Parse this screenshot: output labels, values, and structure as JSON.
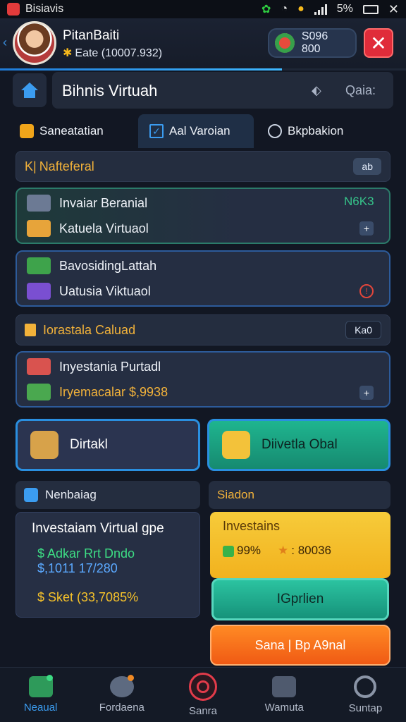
{
  "status_bar": {
    "app_name": "Bisiavis",
    "battery": "5%",
    "icons": [
      "app-icon",
      "wifi-icon",
      "bulb-icon",
      "signal-icon",
      "battery-icon",
      "close-icon"
    ]
  },
  "header": {
    "profile_name": "PitanBaiti",
    "profile_sub": "Eate (10007.932)",
    "coins": "S096 800",
    "close_label": "✕"
  },
  "title_bar": {
    "title": "Bihnis Virtuah",
    "search_text": "Qaia:"
  },
  "tabs": [
    {
      "label": "Saneatatian",
      "icon": "lock-icon"
    },
    {
      "label": "Aal Varoian",
      "icon": "check-icon",
      "active": true
    },
    {
      "label": "Bkpbakion",
      "icon": "clock-icon"
    }
  ],
  "section1": {
    "label": "Nafteferal",
    "prefix": "K|",
    "tag": "ab"
  },
  "cards": [
    {
      "title": "Invaiar Beranial",
      "subtitle": "Katuela Virtuaol",
      "badge": "N6K3",
      "action": "+"
    },
    {
      "title": "BavosidingLattah",
      "subtitle": "Uatusia Viktuaol",
      "action": "!"
    }
  ],
  "section2": {
    "label": "Iorastala Caluad",
    "tag": "Ka0"
  },
  "card3": {
    "title": "Inyestania Purtadl",
    "subtitle": "Iryemacalar $,9938",
    "action": "+"
  },
  "big_buttons": {
    "left": "Dirtakl",
    "right": "Diivetla Obal"
  },
  "left_panel": {
    "header": "Nenbaiag",
    "title": "Investaiam Virtual gpe",
    "line1": "$ Adkar Rrt Dndo",
    "line2": "$,1011 17/280",
    "line3": "$ Sket (33,7085%"
  },
  "right_panel": {
    "header": "Siadon",
    "gold_title": "Investains",
    "stat1": "99%",
    "stat2": ": 80036",
    "option_label": "IGprlien",
    "orange_label": "Sana | Bp A9nal"
  },
  "bottom_nav": [
    {
      "label": "Neaual",
      "active": true
    },
    {
      "label": "Fordaena"
    },
    {
      "label": "Sanra"
    },
    {
      "label": "Wamuta"
    },
    {
      "label": "Suntap"
    }
  ],
  "colors": {
    "background": "#121723",
    "accent_blue": "#3b9cf0",
    "accent_teal": "#1fb58f",
    "gold": "#f6cb3a",
    "orange": "#f05a14",
    "danger": "#e02c3a"
  }
}
